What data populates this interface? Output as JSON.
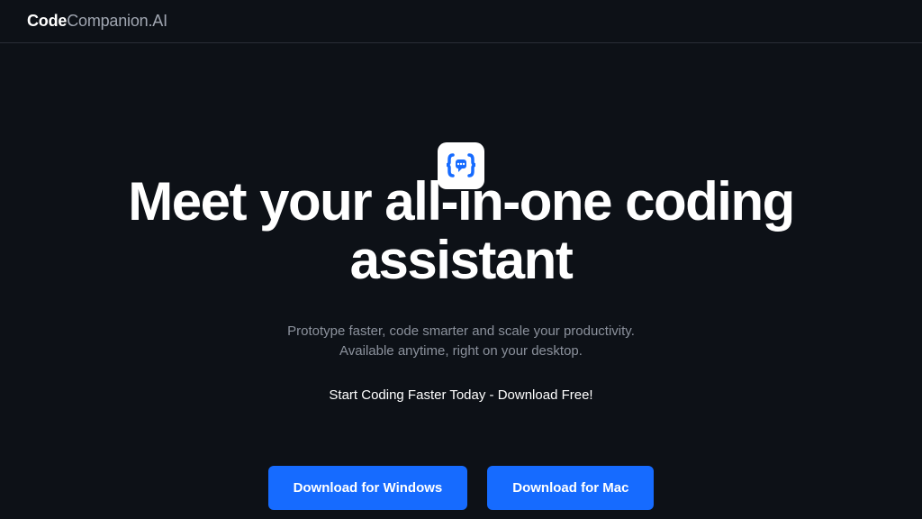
{
  "header": {
    "logo_bold": "Code",
    "logo_light": "Companion.AI"
  },
  "hero": {
    "headline": "Meet your all-in-one coding assistant",
    "subtitle_line1": "Prototype faster, code smarter and scale your productivity.",
    "subtitle_line2": "Available anytime, right on your desktop.",
    "cta_text": "Start Coding Faster Today - Download Free!"
  },
  "buttons": {
    "windows": "Download for Windows",
    "mac": "Download for Mac"
  }
}
